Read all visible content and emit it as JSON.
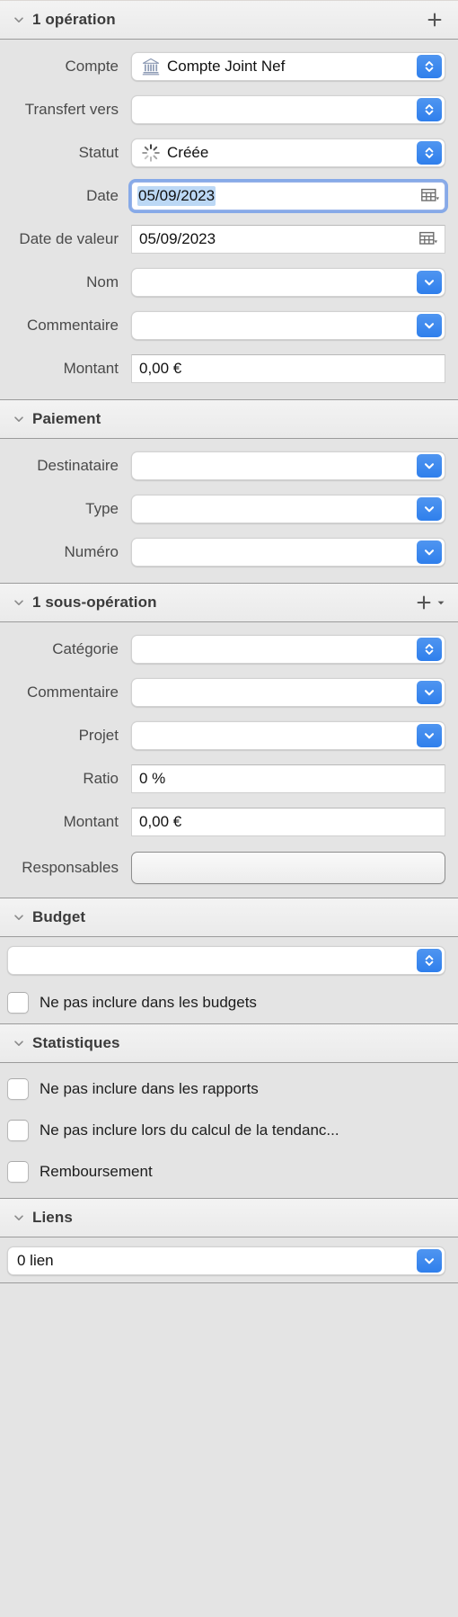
{
  "sections": {
    "operation": {
      "title": "1 opération",
      "add_label": "+",
      "fields": {
        "compte": {
          "label": "Compte",
          "value": "Compte Joint Nef",
          "icon": "bank-icon"
        },
        "transfert": {
          "label": "Transfert vers",
          "value": ""
        },
        "statut": {
          "label": "Statut",
          "value": "Créée",
          "icon": "spinner-icon"
        },
        "date": {
          "label": "Date",
          "value": "05/09/2023"
        },
        "date_valeur": {
          "label": "Date de valeur",
          "value": "05/09/2023"
        },
        "nom": {
          "label": "Nom",
          "value": ""
        },
        "commentaire": {
          "label": "Commentaire",
          "value": ""
        },
        "montant": {
          "label": "Montant",
          "value": "0,00 €"
        }
      }
    },
    "paiement": {
      "title": "Paiement",
      "fields": {
        "destinataire": {
          "label": "Destinataire",
          "value": ""
        },
        "type": {
          "label": "Type",
          "value": ""
        },
        "numero": {
          "label": "Numéro",
          "value": ""
        }
      }
    },
    "sous_operation": {
      "title": "1 sous-opération",
      "add_label": "+",
      "fields": {
        "categorie": {
          "label": "Catégorie",
          "value": ""
        },
        "commentaire": {
          "label": "Commentaire",
          "value": ""
        },
        "projet": {
          "label": "Projet",
          "value": ""
        },
        "ratio": {
          "label": "Ratio",
          "value": "0 %"
        },
        "montant": {
          "label": "Montant",
          "value": "0,00 €"
        },
        "responsables": {
          "label": "Responsables",
          "value": ""
        }
      }
    },
    "budget": {
      "title": "Budget",
      "select": {
        "value": ""
      },
      "checkbox": {
        "label": "Ne pas inclure dans les budgets",
        "checked": false
      }
    },
    "statistiques": {
      "title": "Statistiques",
      "checkboxes": [
        {
          "label": "Ne pas inclure dans les rapports",
          "checked": false
        },
        {
          "label": "Ne pas inclure lors du calcul de la tendanc...",
          "checked": false
        },
        {
          "label": "Remboursement",
          "checked": false
        }
      ]
    },
    "liens": {
      "title": "Liens",
      "select": {
        "value": "0 lien"
      }
    }
  },
  "colors": {
    "accent": "#2f7fec",
    "panel_bg": "#e4e4e4",
    "header_bg": "#eeeeee",
    "selection": "#bcd8f5",
    "focus_ring": "#82a6e8"
  }
}
